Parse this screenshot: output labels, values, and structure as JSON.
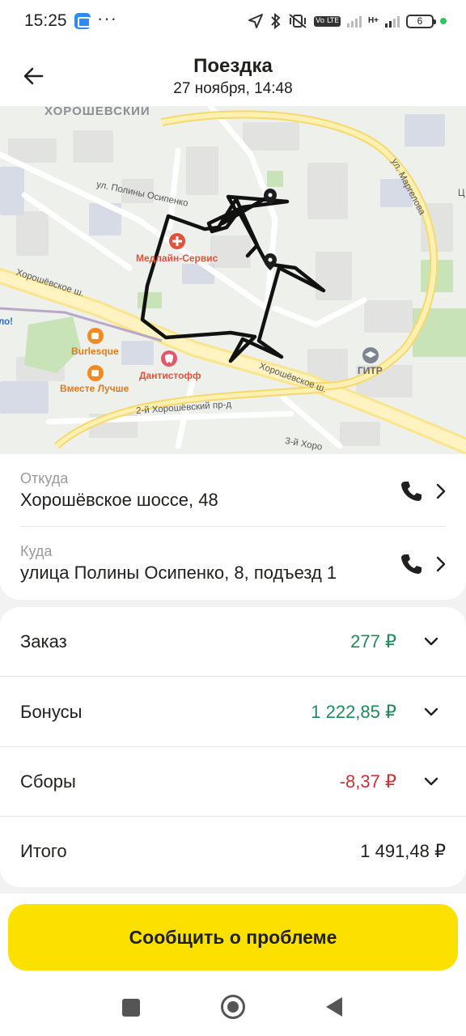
{
  "status_bar": {
    "time": "15:25",
    "dots": "···",
    "volte": "Vo LTE",
    "network": "H+",
    "battery": "6"
  },
  "header": {
    "title": "Поездка",
    "subtitle": "27 ноября, 14:48"
  },
  "map": {
    "district": "ХОРОШЁВСКИЙ",
    "streets": {
      "polina": "ул. Полины Осипенко",
      "horosh_left": "Хорошёвское ш.",
      "horosh_right": "Хорошёвское ш.",
      "proezd2": "2-й Хорошёвский пр-д",
      "proezd3": "3-й Хоро",
      "margelova": "ул. Маргелова"
    },
    "pois": {
      "medline": "Медлайн-Сервис",
      "burlesque": "Burlesque",
      "dantistoff": "Дантистофф",
      "vmeste": "Вместе Лучше",
      "gitr": "ГИТР"
    },
    "edge_text": {
      "left": "ло!",
      "right": "Ц"
    }
  },
  "addresses": {
    "from": {
      "caption": "Откуда",
      "value": "Хорошёвское шоссе, 48"
    },
    "to": {
      "caption": "Куда",
      "value": "улица Полины Осипенко, 8, подъезд 1"
    }
  },
  "payments": {
    "order": {
      "label": "Заказ",
      "value": "277 ₽"
    },
    "bonuses": {
      "label": "Бонусы",
      "value": "1 222,85 ₽"
    },
    "fees": {
      "label": "Сборы",
      "value": "-8,37 ₽"
    },
    "total": {
      "label": "Итого",
      "value": "1 491,48 ₽"
    }
  },
  "actions": {
    "report_label": "Сообщить о проблеме"
  },
  "colors": {
    "accent_yellow": "#fce000",
    "positive_green": "#1f8a5a",
    "negative_red": "#c8323a"
  }
}
